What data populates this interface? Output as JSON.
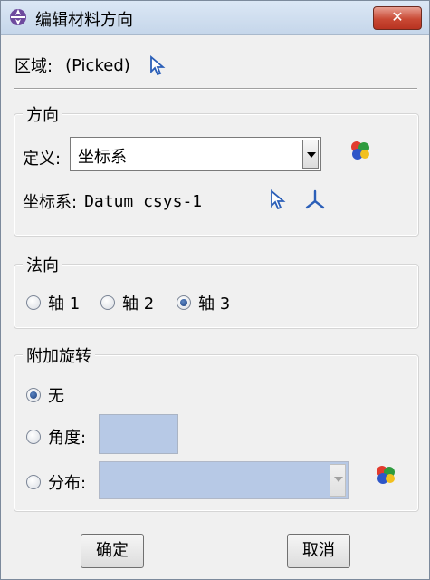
{
  "window": {
    "title": "编辑材料方向",
    "close_label": "✕"
  },
  "region": {
    "label": "区域:",
    "value": "(Picked)"
  },
  "orientation": {
    "legend": "方向",
    "definition_label": "定义:",
    "definition_value": "坐标系",
    "csys_label": "坐标系:",
    "csys_value": "Datum csys-1"
  },
  "normal": {
    "legend": "法向",
    "options": [
      {
        "label": "轴 1",
        "selected": false
      },
      {
        "label": "轴 2",
        "selected": false
      },
      {
        "label": "轴 3",
        "selected": true
      }
    ]
  },
  "rotation": {
    "legend": "附加旋转",
    "none_label": "无",
    "angle_label": "角度:",
    "angle_value": "",
    "distribution_label": "分布:",
    "distribution_value": ""
  },
  "buttons": {
    "ok": "确定",
    "cancel": "取消"
  },
  "colors": {
    "field_disabled": "#b7c9e6",
    "pick_arrow": "#2b5fb8"
  }
}
